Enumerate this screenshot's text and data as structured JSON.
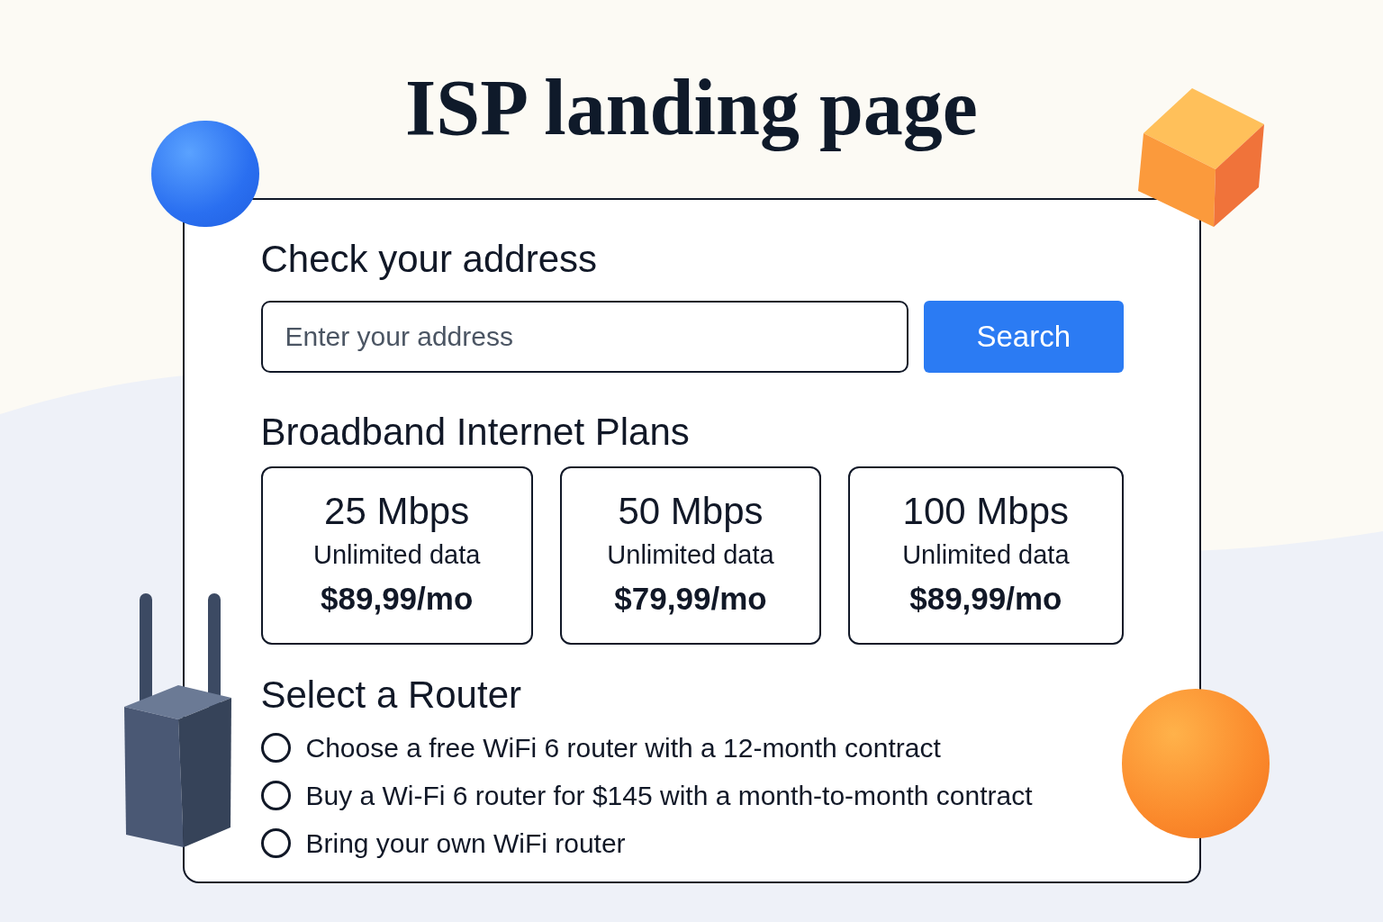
{
  "title": "ISP landing page",
  "address": {
    "heading": "Check your address",
    "placeholder": "Enter your address",
    "button": "Search"
  },
  "plans": {
    "heading": "Broadband Internet Plans",
    "items": [
      {
        "speed": "25 Mbps",
        "data": "Unlimited data",
        "price": "$89,99/mo"
      },
      {
        "speed": "50 Mbps",
        "data": "Unlimited data",
        "price": "$79,99/mo"
      },
      {
        "speed": "100 Mbps",
        "data": "Unlimited data",
        "price": "$89,99/mo"
      }
    ]
  },
  "router": {
    "heading": "Select a Router",
    "options": [
      {
        "label": "Choose a free WiFi 6 router with a 12-month contract",
        "selected": false
      },
      {
        "label": "Buy a Wi-Fi 6 router for $145 with a month-to-month contract",
        "selected": false
      },
      {
        "label": "Bring your own WiFi router",
        "selected": false
      }
    ]
  }
}
